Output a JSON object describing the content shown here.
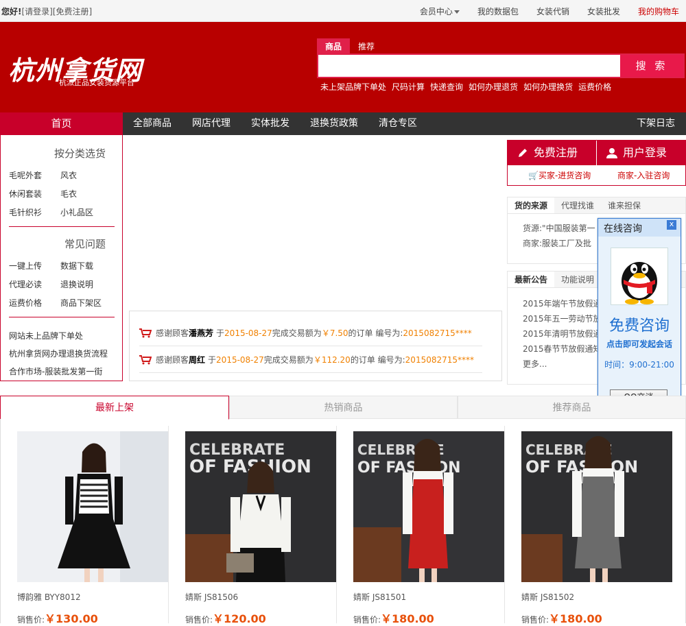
{
  "topbar": {
    "greeting": "您好!",
    "login": "[请登录]",
    "register": "[免费注册]",
    "links": [
      "会员中心",
      "我的数据包",
      "女装代销",
      "女装批发"
    ],
    "cart": "我的购物车"
  },
  "header": {
    "logo": "杭州拿货网",
    "slogan": "杭派正品女装货源平台",
    "search_tabs": [
      "商品",
      "推荐"
    ],
    "search_placeholder": "",
    "search_button": "搜 索",
    "quick_links": [
      "未上架品牌下单处",
      "尺码计算",
      "快递查询",
      "如何办理退货",
      "如何办理换货",
      "运费价格"
    ]
  },
  "nav": {
    "home": "首页",
    "items": [
      "全部商品",
      "网店代理",
      "实体批发",
      "退换货政策",
      "清仓专区"
    ],
    "right": "下架日志"
  },
  "left": {
    "cat_title": "按分类选货",
    "cats": [
      "毛呢外套",
      "风衣",
      "休闲套装",
      "毛衣",
      "毛针织衫",
      "小礼品区"
    ],
    "faq_title": "常见问题",
    "faqs": [
      "一键上传",
      "数据下载",
      "代理必读",
      "退换说明",
      "运费价格",
      "商品下架区"
    ],
    "links": [
      "网站未上品牌下单处",
      "杭州拿货网办理退换货流程",
      "合作市场-服装批发第一街"
    ]
  },
  "orders": [
    {
      "prefix": "感谢顾客",
      "name": "潘燕芳",
      "mid1": "于",
      "date": "2015-08-27",
      "mid2": "完成交易额为",
      "amount": "￥7.50",
      "mid3": "的订单  编号为:",
      "no": "2015082715****"
    },
    {
      "prefix": "感谢顾客",
      "name": "周红",
      "mid1": "于",
      "date": "2015-08-27",
      "mid2": "完成交易额为",
      "amount": "￥112.20",
      "mid3": "的订单  编号为:",
      "no": "2015082715****"
    }
  ],
  "right": {
    "register": "免费注册",
    "login": "用户登录",
    "buyer": "买家-进货咨询",
    "seller": "商家-入驻咨询",
    "src_tabs": [
      "货的来源",
      "代理找谁",
      "谁来担保"
    ],
    "src_lines": [
      "货源:\"中国服装第一",
      "商家:服装工厂及批"
    ],
    "notice_tabs": [
      "最新公告",
      "功能说明"
    ],
    "notices": [
      "2015年端午节放假通",
      "2015年五一劳动节放",
      "2015年清明节放假通",
      "2015春节节放假通知",
      "更多..."
    ]
  },
  "qq": {
    "title": "在线咨询",
    "close": "x",
    "big": "免费咨询",
    "sub": "点击即可发起会话",
    "time": "时间：9:00-21:00",
    "button": "QQ交谈"
  },
  "product_tabs": [
    "最新上架",
    "热销商品",
    "推荐商品"
  ],
  "products": [
    {
      "name": "博韵雅  BYY8012",
      "price_label": "销售价:",
      "price": "￥130.00",
      "color": "#111111"
    },
    {
      "name": "婧斯  JS81506",
      "price_label": "销售价:",
      "price": "￥120.00",
      "color": "#f4f4f0"
    },
    {
      "name": "婧斯  JS81501",
      "price_label": "销售价:",
      "price": "￥180.00",
      "color": "#c8201e"
    },
    {
      "name": "婧斯  JS81502",
      "price_label": "销售价:",
      "price": "￥180.00",
      "color": "#6b6b6b"
    }
  ],
  "photo_text": [
    "CELEBRATE",
    "OF FASHION"
  ]
}
